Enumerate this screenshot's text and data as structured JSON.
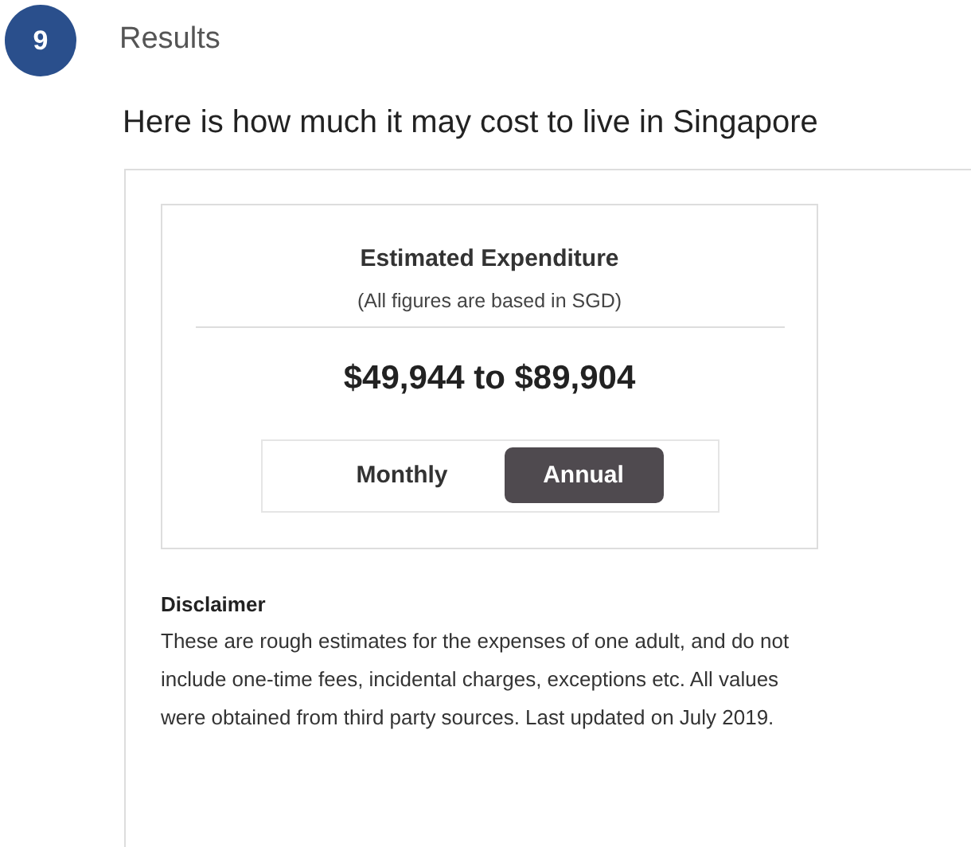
{
  "step": {
    "number": "9",
    "label": "Results"
  },
  "heading": "Here is how much it may cost to live in Singapore",
  "card": {
    "title": "Estimated Expenditure",
    "subtitle": "(All figures are based in SGD)",
    "amount": "$49,944 to $89,904",
    "toggle": [
      {
        "label": "Monthly",
        "selected": false
      },
      {
        "label": "Annual",
        "selected": true
      }
    ]
  },
  "disclaimer": {
    "title": "Disclaimer",
    "text": "These are rough estimates for the expenses of one adult, and do not include one-time fees, incidental charges, exceptions etc. All values were obtained from third party sources. Last updated on July 2019."
  }
}
